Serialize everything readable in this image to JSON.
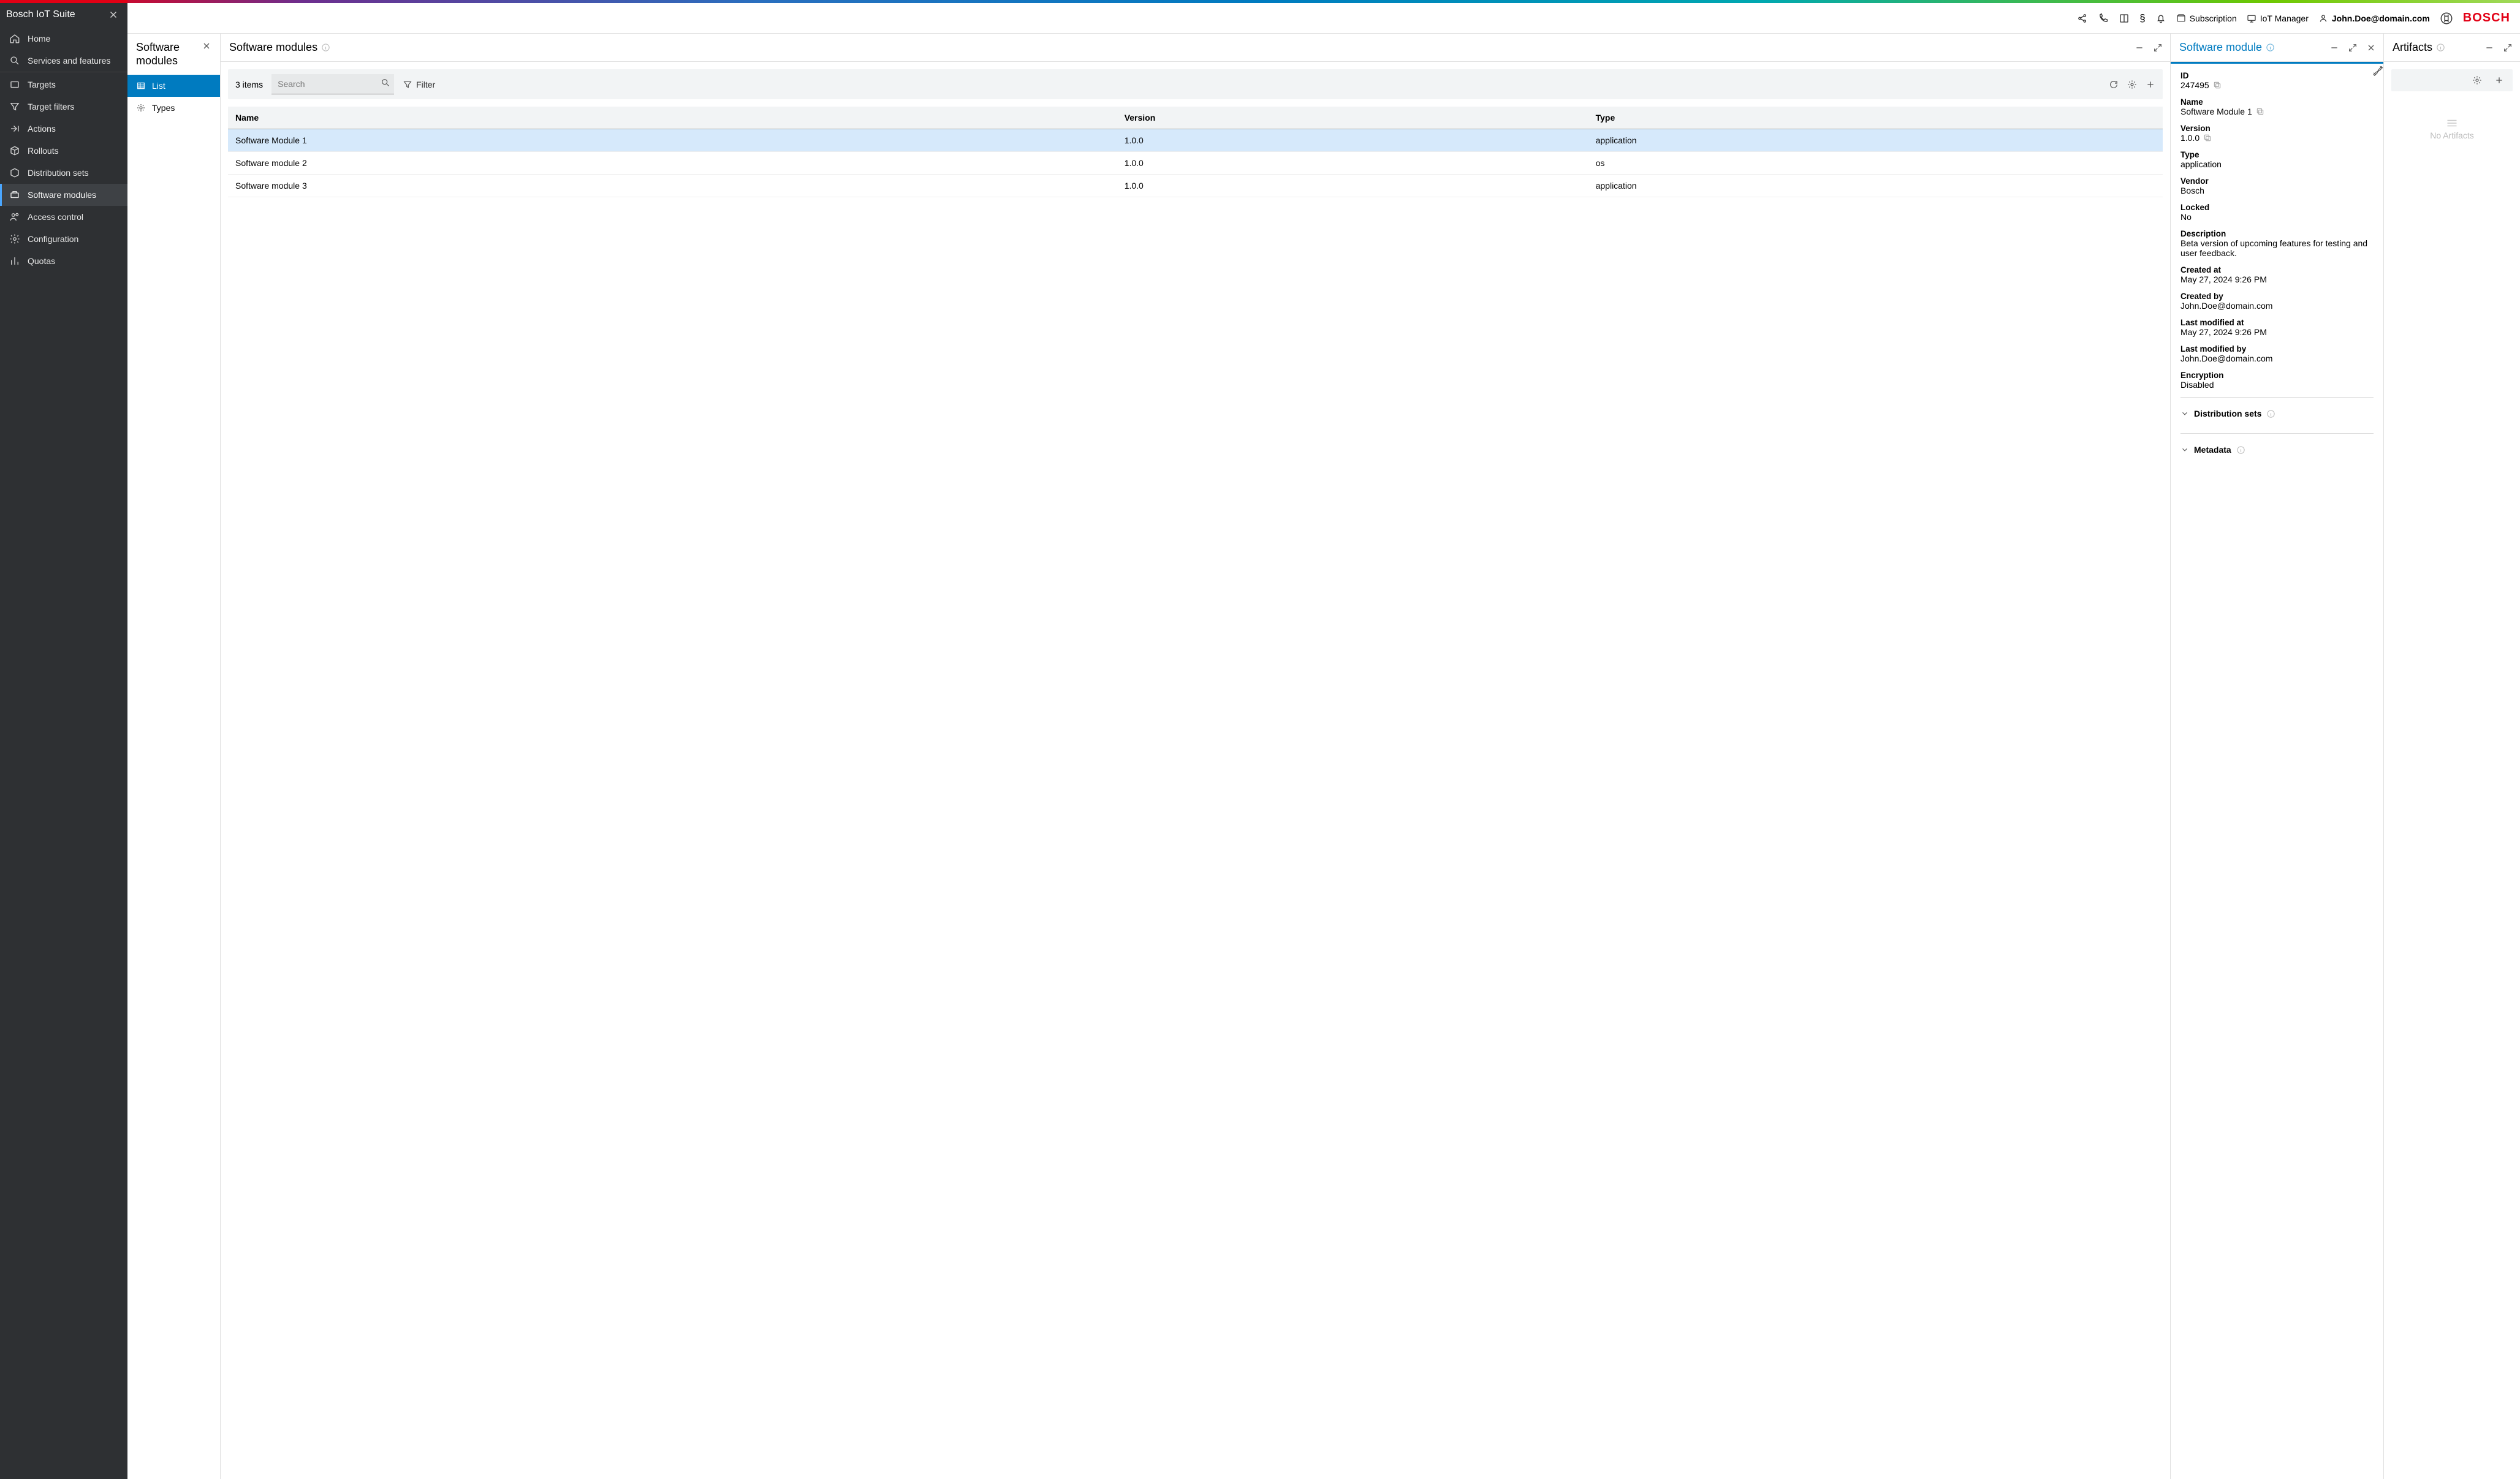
{
  "app_title": "Bosch IoT Suite",
  "brand": "BOSCH",
  "header": {
    "subscription": "Subscription",
    "iot_manager": "IoT Manager",
    "user": "John.Doe@domain.com"
  },
  "sidebar": {
    "items": [
      {
        "label": "Home"
      },
      {
        "label": "Services and features"
      },
      {
        "label": "Targets"
      },
      {
        "label": "Target filters"
      },
      {
        "label": "Actions"
      },
      {
        "label": "Rollouts"
      },
      {
        "label": "Distribution sets"
      },
      {
        "label": "Software modules"
      },
      {
        "label": "Access control"
      },
      {
        "label": "Configuration"
      },
      {
        "label": "Quotas"
      }
    ],
    "active_index": 7
  },
  "subnav": {
    "title": "Software modules",
    "items": [
      {
        "label": "List"
      },
      {
        "label": "Types"
      }
    ],
    "active_index": 0
  },
  "modules_panel": {
    "title": "Software modules",
    "count_label": "3 items",
    "search_placeholder": "Search",
    "filter_label": "Filter",
    "columns": [
      "Name",
      "Version",
      "Type"
    ],
    "rows": [
      {
        "name": "Software Module 1",
        "version": "1.0.0",
        "type": "application",
        "selected": true
      },
      {
        "name": "Software module 2",
        "version": "1.0.0",
        "type": "os",
        "selected": false
      },
      {
        "name": "Software module 3",
        "version": "1.0.0",
        "type": "application",
        "selected": false
      }
    ]
  },
  "details_panel": {
    "title": "Software module",
    "fields": {
      "id_label": "ID",
      "id_value": "247495",
      "name_label": "Name",
      "name_value": "Software Module 1",
      "version_label": "Version",
      "version_value": "1.0.0",
      "type_label": "Type",
      "type_value": "application",
      "vendor_label": "Vendor",
      "vendor_value": "Bosch",
      "locked_label": "Locked",
      "locked_value": "No",
      "description_label": "Description",
      "description_value": "Beta version of upcoming features for testing and user feedback.",
      "created_at_label": "Created at",
      "created_at_value": "May 27, 2024 9:26 PM",
      "created_by_label": "Created by",
      "created_by_value": "John.Doe@domain.com",
      "modified_at_label": "Last modified at",
      "modified_at_value": "May 27, 2024 9:26 PM",
      "modified_by_label": "Last modified by",
      "modified_by_value": "John.Doe@domain.com",
      "encryption_label": "Encryption",
      "encryption_value": "Disabled"
    },
    "sections": {
      "distribution_sets": "Distribution sets",
      "metadata": "Metadata"
    }
  },
  "artifacts_panel": {
    "title": "Artifacts",
    "empty_label": "No Artifacts"
  }
}
